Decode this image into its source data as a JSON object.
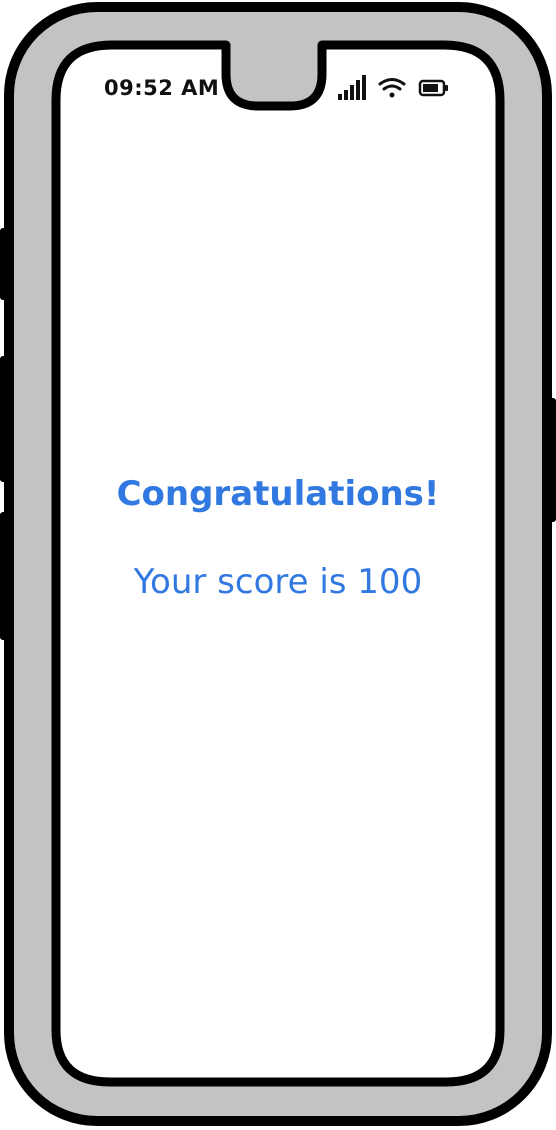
{
  "status_bar": {
    "time": "09:52 AM",
    "icons": [
      "cellular-signal-icon",
      "wifi-icon",
      "battery-icon"
    ]
  },
  "screen": {
    "headline": "Congratulations!",
    "score_text": "Your score is 100"
  },
  "colors": {
    "text_accent": "#3178e0",
    "phone_frame": "#c3c3c3",
    "outline": "#000000",
    "screen_bg": "#ffffff"
  }
}
